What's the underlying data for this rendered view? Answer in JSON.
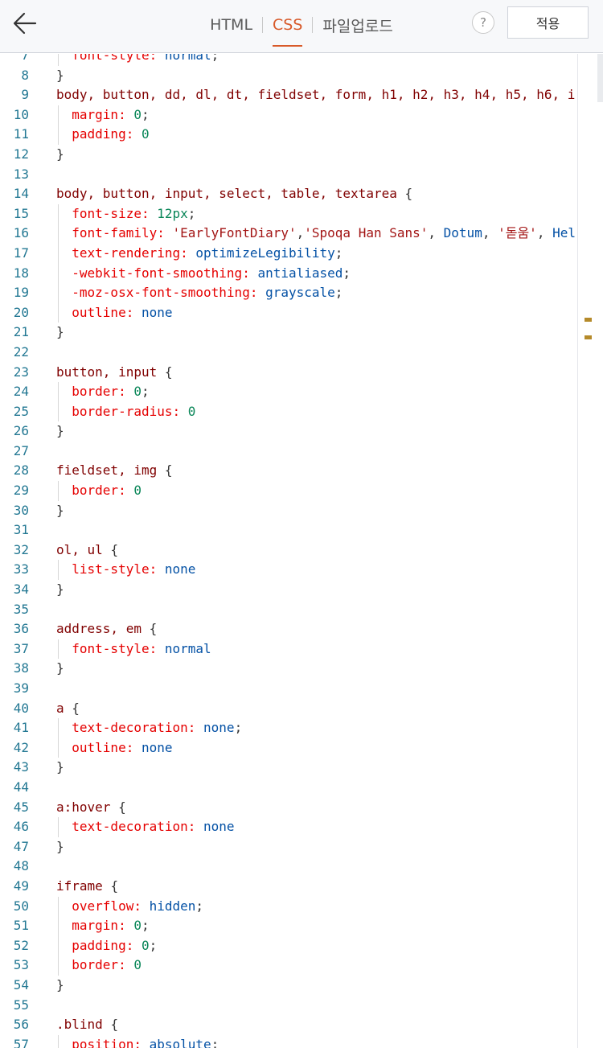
{
  "header": {
    "tabs": [
      {
        "label": "HTML",
        "active": false
      },
      {
        "label": "CSS",
        "active": true
      },
      {
        "label": "파일업로드",
        "active": false
      }
    ],
    "help_label": "?",
    "apply_label": "적용"
  },
  "colors": {
    "accent": "#d85a2a",
    "line_number": "#237893",
    "selector": "#800000",
    "property": "#e50000",
    "value": "#0451a5",
    "number": "#098658",
    "string": "#a31515"
  },
  "editor": {
    "lines": [
      {
        "n": "7",
        "guide": true,
        "tokens": [
          [
            "prop",
            "  font-style: "
          ],
          [
            "val",
            "normal"
          ],
          [
            "p",
            ";"
          ]
        ]
      },
      {
        "n": "8",
        "tokens": [
          [
            "p",
            "}"
          ]
        ]
      },
      {
        "n": "9",
        "tokens": [
          [
            "sel",
            "body, button, dd, dl, dt, fieldset, form, h1, h2, h3, h4, h5, h6, i"
          ]
        ]
      },
      {
        "n": "10",
        "guide": true,
        "tokens": [
          [
            "prop",
            "  margin: "
          ],
          [
            "num",
            "0"
          ],
          [
            "p",
            ";"
          ]
        ]
      },
      {
        "n": "11",
        "guide": true,
        "tokens": [
          [
            "prop",
            "  padding: "
          ],
          [
            "num",
            "0"
          ]
        ]
      },
      {
        "n": "12",
        "tokens": [
          [
            "p",
            "}"
          ]
        ]
      },
      {
        "n": "13",
        "tokens": []
      },
      {
        "n": "14",
        "tokens": [
          [
            "sel",
            "body, button, input, select, table, textarea "
          ],
          [
            "p",
            "{"
          ]
        ]
      },
      {
        "n": "15",
        "guide": true,
        "tokens": [
          [
            "prop",
            "  font-size: "
          ],
          [
            "num",
            "12px"
          ],
          [
            "p",
            ";"
          ]
        ]
      },
      {
        "n": "16",
        "guide": true,
        "tokens": [
          [
            "prop",
            "  font-family: "
          ],
          [
            "str",
            "'EarlyFontDiary'"
          ],
          [
            "p",
            ","
          ],
          [
            "str",
            "'Spoqa Han Sans'"
          ],
          [
            "p",
            ", "
          ],
          [
            "val",
            "Dotum"
          ],
          [
            "p",
            ", "
          ],
          [
            "str",
            "'돋움'"
          ],
          [
            "p",
            ", "
          ],
          [
            "val",
            "Hel"
          ]
        ]
      },
      {
        "n": "17",
        "guide": true,
        "tokens": [
          [
            "prop",
            "  text-rendering: "
          ],
          [
            "val",
            "optimizeLegibility"
          ],
          [
            "p",
            ";"
          ]
        ]
      },
      {
        "n": "18",
        "guide": true,
        "tokens": [
          [
            "prop",
            "  -webkit-font-smoothing: "
          ],
          [
            "val",
            "antialiased"
          ],
          [
            "p",
            ";"
          ]
        ]
      },
      {
        "n": "19",
        "guide": true,
        "tokens": [
          [
            "prop",
            "  -moz-osx-font-smoothing: "
          ],
          [
            "val",
            "grayscale"
          ],
          [
            "p",
            ";"
          ]
        ]
      },
      {
        "n": "20",
        "guide": true,
        "tokens": [
          [
            "prop",
            "  outline: "
          ],
          [
            "val",
            "none"
          ]
        ]
      },
      {
        "n": "21",
        "tokens": [
          [
            "p",
            "}"
          ]
        ]
      },
      {
        "n": "22",
        "tokens": []
      },
      {
        "n": "23",
        "tokens": [
          [
            "sel",
            "button, input "
          ],
          [
            "p",
            "{"
          ]
        ]
      },
      {
        "n": "24",
        "guide": true,
        "tokens": [
          [
            "prop",
            "  border: "
          ],
          [
            "num",
            "0"
          ],
          [
            "p",
            ";"
          ]
        ]
      },
      {
        "n": "25",
        "guide": true,
        "tokens": [
          [
            "prop",
            "  border-radius: "
          ],
          [
            "num",
            "0"
          ]
        ]
      },
      {
        "n": "26",
        "tokens": [
          [
            "p",
            "}"
          ]
        ]
      },
      {
        "n": "27",
        "tokens": []
      },
      {
        "n": "28",
        "tokens": [
          [
            "sel",
            "fieldset, img "
          ],
          [
            "p",
            "{"
          ]
        ]
      },
      {
        "n": "29",
        "guide": true,
        "tokens": [
          [
            "prop",
            "  border: "
          ],
          [
            "num",
            "0"
          ]
        ]
      },
      {
        "n": "30",
        "tokens": [
          [
            "p",
            "}"
          ]
        ]
      },
      {
        "n": "31",
        "tokens": []
      },
      {
        "n": "32",
        "tokens": [
          [
            "sel",
            "ol, ul "
          ],
          [
            "p",
            "{"
          ]
        ]
      },
      {
        "n": "33",
        "guide": true,
        "tokens": [
          [
            "prop",
            "  list-style: "
          ],
          [
            "val",
            "none"
          ]
        ]
      },
      {
        "n": "34",
        "tokens": [
          [
            "p",
            "}"
          ]
        ]
      },
      {
        "n": "35",
        "tokens": []
      },
      {
        "n": "36",
        "tokens": [
          [
            "sel",
            "address, em "
          ],
          [
            "p",
            "{"
          ]
        ]
      },
      {
        "n": "37",
        "guide": true,
        "tokens": [
          [
            "prop",
            "  font-style: "
          ],
          [
            "val",
            "normal"
          ]
        ]
      },
      {
        "n": "38",
        "tokens": [
          [
            "p",
            "}"
          ]
        ]
      },
      {
        "n": "39",
        "tokens": []
      },
      {
        "n": "40",
        "tokens": [
          [
            "sel",
            "a "
          ],
          [
            "p",
            "{"
          ]
        ]
      },
      {
        "n": "41",
        "guide": true,
        "tokens": [
          [
            "prop",
            "  text-decoration: "
          ],
          [
            "val",
            "none"
          ],
          [
            "p",
            ";"
          ]
        ]
      },
      {
        "n": "42",
        "guide": true,
        "tokens": [
          [
            "prop",
            "  outline: "
          ],
          [
            "val",
            "none"
          ]
        ]
      },
      {
        "n": "43",
        "tokens": [
          [
            "p",
            "}"
          ]
        ]
      },
      {
        "n": "44",
        "tokens": []
      },
      {
        "n": "45",
        "tokens": [
          [
            "sel",
            "a:hover "
          ],
          [
            "p",
            "{"
          ]
        ]
      },
      {
        "n": "46",
        "guide": true,
        "tokens": [
          [
            "prop",
            "  text-decoration: "
          ],
          [
            "val",
            "none"
          ]
        ]
      },
      {
        "n": "47",
        "tokens": [
          [
            "p",
            "}"
          ]
        ]
      },
      {
        "n": "48",
        "tokens": []
      },
      {
        "n": "49",
        "tokens": [
          [
            "sel",
            "iframe "
          ],
          [
            "p",
            "{"
          ]
        ]
      },
      {
        "n": "50",
        "guide": true,
        "tokens": [
          [
            "prop",
            "  overflow: "
          ],
          [
            "val",
            "hidden"
          ],
          [
            "p",
            ";"
          ]
        ]
      },
      {
        "n": "51",
        "guide": true,
        "tokens": [
          [
            "prop",
            "  margin: "
          ],
          [
            "num",
            "0"
          ],
          [
            "p",
            ";"
          ]
        ]
      },
      {
        "n": "52",
        "guide": true,
        "tokens": [
          [
            "prop",
            "  padding: "
          ],
          [
            "num",
            "0"
          ],
          [
            "p",
            ";"
          ]
        ]
      },
      {
        "n": "53",
        "guide": true,
        "tokens": [
          [
            "prop",
            "  border: "
          ],
          [
            "num",
            "0"
          ]
        ]
      },
      {
        "n": "54",
        "tokens": [
          [
            "p",
            "}"
          ]
        ]
      },
      {
        "n": "55",
        "tokens": []
      },
      {
        "n": "56",
        "tokens": [
          [
            "sel",
            ".blind "
          ],
          [
            "p",
            "{"
          ]
        ]
      },
      {
        "n": "57",
        "guide": true,
        "tokens": [
          [
            "prop",
            "  position: "
          ],
          [
            "val",
            "absolute"
          ],
          [
            "p",
            ";"
          ]
        ]
      }
    ]
  }
}
